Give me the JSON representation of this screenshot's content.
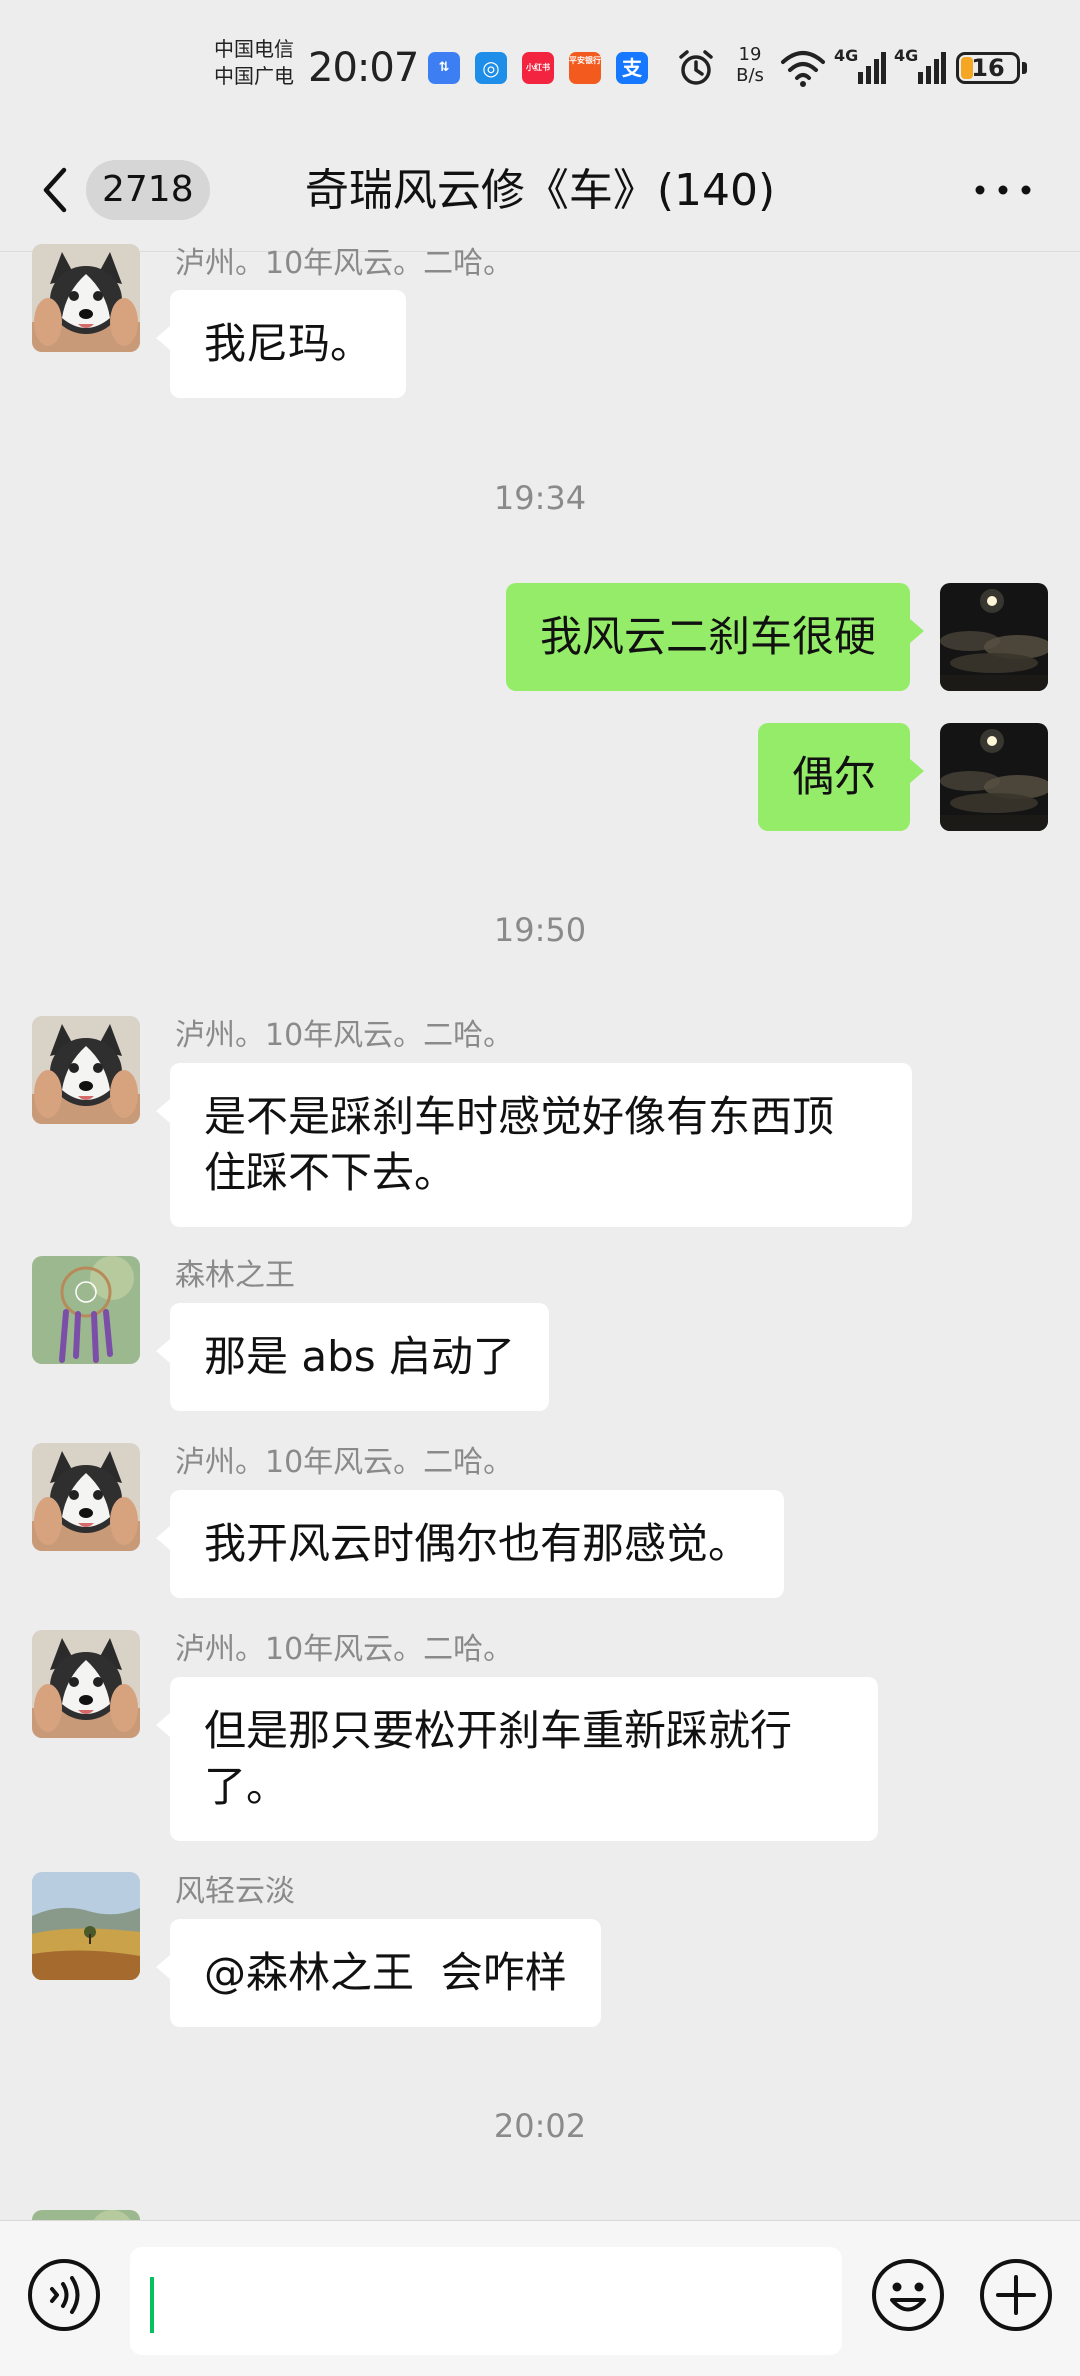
{
  "status_bar": {
    "carrier_1": "中国电信",
    "carrier_2": "中国广电",
    "time": "20:07",
    "net_speed_value": "19",
    "net_speed_unit": "B/s",
    "signal_1": "4G",
    "signal_2": "4G",
    "battery": "16",
    "app_icons": [
      "qq-sync-icon",
      "browser-icon",
      "xiaohongshu-icon",
      "pingan-bank-icon",
      "alipay-icon"
    ],
    "app_icon_labels": [
      "⇅",
      "◎",
      "小红书",
      "平安银行",
      "支"
    ]
  },
  "nav": {
    "unread_count": "2718",
    "title": "奇瑞风云修《车》(140)"
  },
  "messages": [
    {
      "side": "left",
      "sender": "泸州。10年风云。二哈。",
      "avatar": "husky-avatar",
      "text": "我尼玛。"
    },
    {
      "type": "time",
      "text": "19:34"
    },
    {
      "side": "right",
      "avatar": "night-sky-avatar",
      "text": "我风云二刹车很硬"
    },
    {
      "side": "right",
      "avatar": "night-sky-avatar",
      "text": "偶尔"
    },
    {
      "type": "time",
      "text": "19:50"
    },
    {
      "side": "left",
      "sender": "泸州。10年风云。二哈。",
      "avatar": "husky-avatar",
      "text": "是不是踩刹车时感觉好像有东西顶\n住踩不下去。"
    },
    {
      "side": "left",
      "sender": "森林之王",
      "avatar": "dreamcatcher-avatar",
      "text": "那是 abs 启动了"
    },
    {
      "side": "left",
      "sender": "泸州。10年风云。二哈。",
      "avatar": "husky-avatar",
      "text": "我开风云时偶尔也有那感觉。"
    },
    {
      "side": "left",
      "sender": "泸州。10年风云。二哈。",
      "avatar": "husky-avatar",
      "text": "但是那只要松开刹车重新踩就行\n了。"
    },
    {
      "side": "left",
      "sender": "风轻云淡",
      "avatar": "landscape-avatar",
      "text": "@森林之王  会咋样"
    },
    {
      "type": "time",
      "text": "20:02"
    }
  ],
  "input": {
    "value": ""
  },
  "colors": {
    "background": "#ededed",
    "self_bubble": "#95ec69",
    "other_bubble": "#ffffff",
    "timestamp": "#8a8a8a",
    "caret": "#07c160"
  }
}
